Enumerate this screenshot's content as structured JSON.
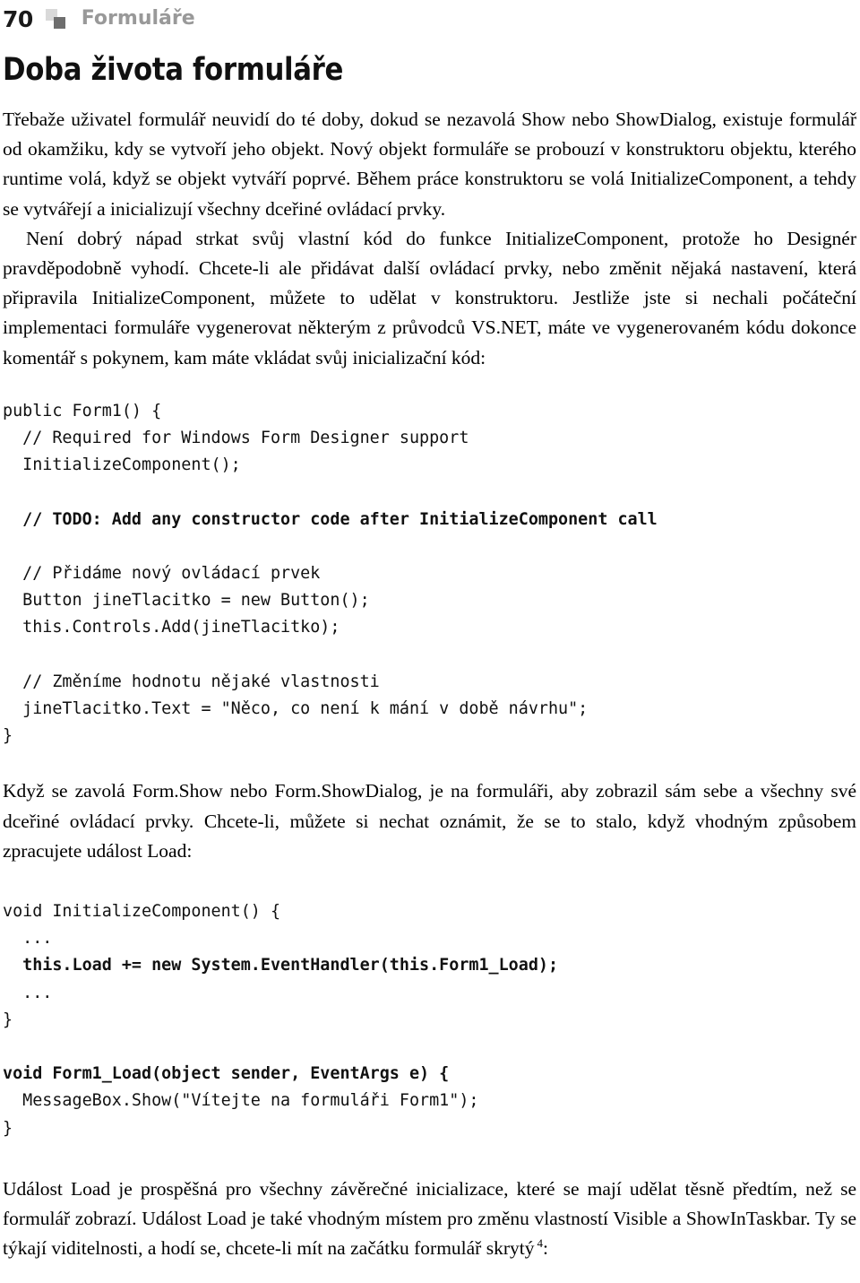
{
  "header": {
    "page_number": "70",
    "chapter_title": "Formuláře",
    "icon_light": "square-light-icon",
    "icon_dark": "square-dark-icon",
    "title_color": "#999999"
  },
  "section": {
    "heading": "Doba života formuláře"
  },
  "paragraphs": {
    "p1": "Třebaže uživatel formulář neuvidí do té doby, dokud se nezavolá Show nebo ShowDialog, existuje formulář od okamžiku, kdy se vytvoří jeho objekt. Nový objekt formuláře se probouzí v konstruktoru objektu, kterého runtime volá, když se objekt vytváří poprvé. Během práce konstruktoru se volá InitializeComponent, a tehdy se vytvářejí a inicializují všechny dceřiné ovládací prvky.",
    "p2": "Není dobrý nápad strkat svůj vlastní kód do funkce InitializeComponent, protože ho Designér pravděpodobně vyhodí. Chcete-li ale přidávat další ovládací prvky, nebo změnit nějaká nastavení, která připravila InitializeComponent, můžete to udělat v konstruktoru. Jestliže jste si nechali počáteční implementaci formuláře vygenerovat některým z průvodců VS.NET, máte ve vygenerovaném kódu dokonce komentář s pokynem, kam máte vkládat svůj inicializační kód:",
    "p3": "Když se zavolá Form.Show nebo Form.ShowDialog, je na formuláři, aby zobrazil sám sebe a všechny své dceřiné ovládací prvky. Chcete-li, můžete si nechat oznámit, že se to stalo, když vhodným způsobem zpracujete událost Load:",
    "p4_part1": "Událost Load je prospěšná pro všechny závěrečné inicializace, které se mají udělat těsně předtím, než se formulář zobrazí. Událost Load je také vhodným místem pro změnu vlastností Visible a ShowInTaskbar. Ty se týkají viditelnosti, a hodí se, chcete-li mít na začátku formulář skrytý",
    "p4_footnote": "4",
    "p4_part2": ":"
  },
  "code_blocks": {
    "block1": {
      "lines": [
        {
          "text": "public Form1() {",
          "bold": false
        },
        {
          "text": "  // Required for Windows Form Designer support",
          "bold": false
        },
        {
          "text": "  InitializeComponent();",
          "bold": false
        },
        {
          "text": "",
          "bold": false
        },
        {
          "text": "  // TODO: Add any constructor code after InitializeComponent call",
          "bold": true
        },
        {
          "text": "",
          "bold": false
        },
        {
          "text": "  // Přidáme nový ovládací prvek",
          "bold": false
        },
        {
          "text": "  Button jineTlacitko = new Button();",
          "bold": false
        },
        {
          "text": "  this.Controls.Add(jineTlacitko);",
          "bold": false
        },
        {
          "text": "",
          "bold": false
        },
        {
          "text": "  // Změníme hodnotu nějaké vlastnosti",
          "bold": false
        },
        {
          "text": "  jineTlacitko.Text = \"Něco, co není k mání v době návrhu\";",
          "bold": false
        },
        {
          "text": "}",
          "bold": false
        }
      ]
    },
    "block2": {
      "lines": [
        {
          "text": "void InitializeComponent() {",
          "bold": false
        },
        {
          "text": "  ...",
          "bold": false
        },
        {
          "text": "  this.Load += new System.EventHandler(this.Form1_Load);",
          "bold": true
        },
        {
          "text": "  ...",
          "bold": false
        },
        {
          "text": "}",
          "bold": false
        }
      ]
    },
    "block3": {
      "lines": [
        {
          "text": "void Form1_Load(object sender, EventArgs e) {",
          "bold": true
        },
        {
          "text": "  MessageBox.Show(\"Vítejte na formuláři Form1\");",
          "bold": false
        },
        {
          "text": "}",
          "bold": false
        }
      ]
    }
  }
}
